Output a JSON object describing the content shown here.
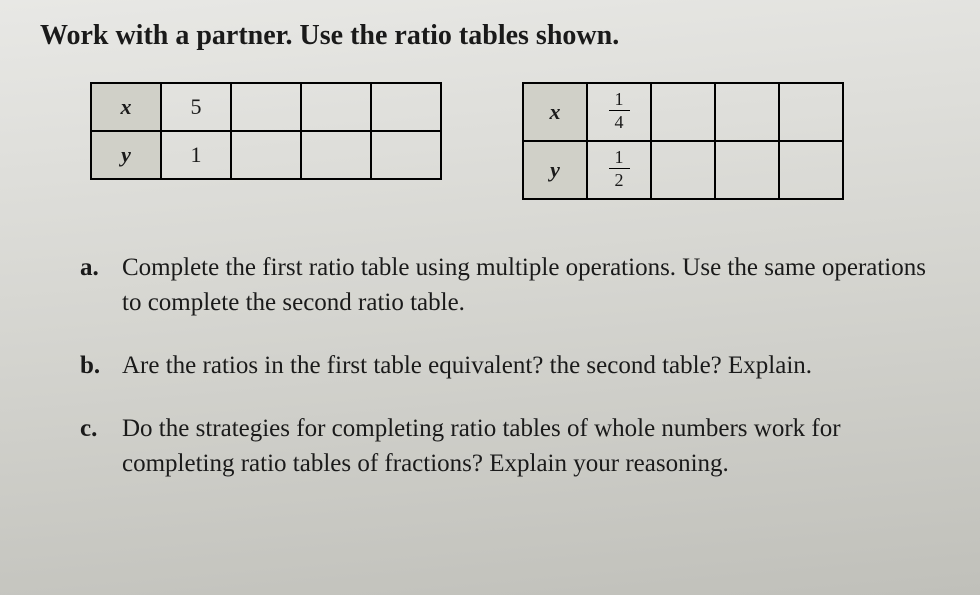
{
  "heading": "Work with a partner. Use the ratio tables shown.",
  "table1": {
    "row1_label": "x",
    "row1_values": [
      "5",
      "",
      "",
      ""
    ],
    "row2_label": "y",
    "row2_values": [
      "1",
      "",
      "",
      ""
    ]
  },
  "table2": {
    "row1_label": "x",
    "row1_values": [
      {
        "num": "1",
        "den": "4"
      },
      "",
      "",
      ""
    ],
    "row2_label": "y",
    "row2_values": [
      {
        "num": "1",
        "den": "2"
      },
      "",
      "",
      ""
    ]
  },
  "questions": {
    "a": {
      "label": "a.",
      "text": "Complete the first ratio table using multiple operations. Use the same operations to complete the second ratio table."
    },
    "b": {
      "label": "b.",
      "text": "Are the ratios in the first table equivalent? the second table? Explain."
    },
    "c": {
      "label": "c.",
      "text": "Do the strategies for completing ratio tables of whole numbers work for completing ratio tables of fractions? Explain your reasoning."
    }
  }
}
